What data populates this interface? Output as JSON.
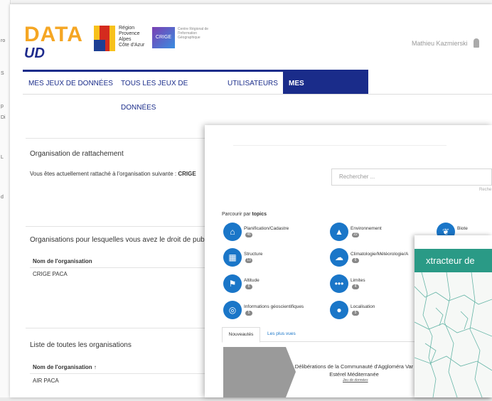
{
  "back_strip": {
    "labels": [
      "ro",
      "S",
      "p",
      "Di",
      "L",
      "d"
    ]
  },
  "header": {
    "logo_data": "DATA",
    "logo_sud": "UD",
    "region_text": [
      "Région",
      "Provence",
      "Alpes",
      "Côte d'Azur"
    ],
    "crige_logo": "CRIGE",
    "crige_text": "Centre Régional de l'Information Géographique",
    "user_name": "Mathieu Kazmierski"
  },
  "nav": {
    "tabs": [
      {
        "label": "MES JEUX DE DONNÉES"
      },
      {
        "label": "TOUS LES JEUX DE DONNÉES"
      },
      {
        "label": "UTILISATEURS"
      },
      {
        "label": "MES ORGANISATIONS"
      }
    ]
  },
  "main": {
    "rattachement_title": "Organisation de rattachement",
    "rattachement_text": "Vous êtes actuellement rattaché à l'organisation suivante : ",
    "rattachement_org": "CRIGE",
    "publish_title": "Organisations pour lesquelles vous avez le droit de publier",
    "publish_col": "Nom de l'organisation",
    "publish_rows": [
      "CRIGE PACA"
    ],
    "all_title": "Liste de toutes les organisations",
    "all_col": "Nom de l'organisation ↑",
    "all_rows": [
      "AIR PACA"
    ]
  },
  "front": {
    "search_placeholder": "Rechercher ...",
    "search_hint": "Reche",
    "topics_title_prefix": "Parcourir par ",
    "topics_title_bold": "topics",
    "topics": [
      {
        "label": "Planification/Cadastre",
        "count": "46",
        "icon": "house-icon"
      },
      {
        "label": "Environnement",
        "count": "22",
        "icon": "tree-icon"
      },
      {
        "label": "Biote",
        "count": "",
        "icon": "leaf-icon"
      },
      {
        "label": "Structure",
        "count": "13",
        "icon": "building-icon"
      },
      {
        "label": "Climatologie/Météorologie/A",
        "count": "6",
        "icon": "cloud-icon"
      },
      {
        "label": "Altitude",
        "count": "6",
        "icon": "flag-icon"
      },
      {
        "label": "Limites",
        "count": "4",
        "icon": "dots-icon"
      },
      {
        "label": "Informations géoscientifiques",
        "count": "5",
        "icon": "target-icon"
      },
      {
        "label": "Localisation",
        "count": "5",
        "icon": "pin-icon"
      }
    ],
    "tab_new": "Nouveautés",
    "tab_popular": "Les plus vues",
    "news_title": "Délibérations de la Communauté d'Aggloméra Var Estérel Méditerranée",
    "news_sub": "Jeu de données"
  },
  "map_window": {
    "title": "xtracteur de"
  },
  "colors": {
    "brand_navy": "#1a2c8a",
    "brand_orange": "#f5a623",
    "topic_blue": "#1a76c8",
    "map_teal": "#2a9a86"
  }
}
